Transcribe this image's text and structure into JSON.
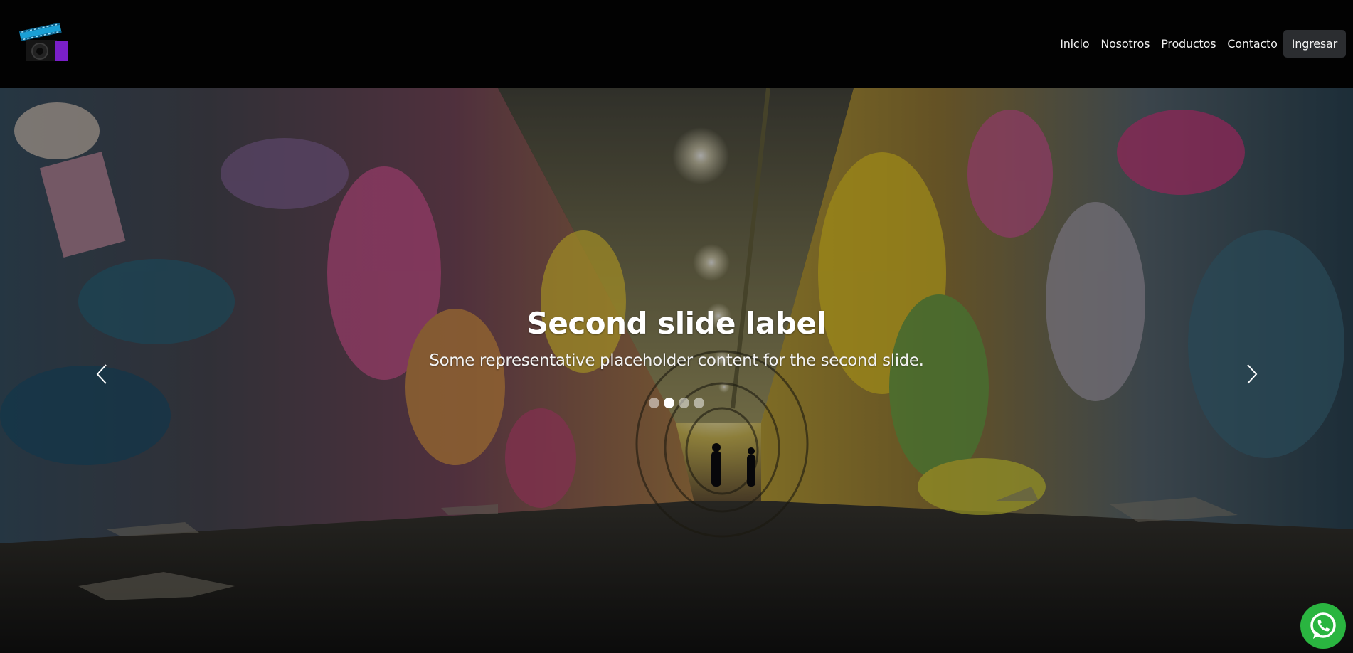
{
  "nav": {
    "logo_icon": "film-camera-icon",
    "links": [
      "Inicio",
      "Nosotros",
      "Productos",
      "Contacto"
    ],
    "login_label": "Ingresar"
  },
  "carousel": {
    "title": "Second slide label",
    "text": "Some representative placeholder content for the second slide.",
    "slide_count": 4,
    "active_index": 1,
    "prev_icon": "chevron-left-icon",
    "next_icon": "chevron-right-icon"
  },
  "floating": {
    "whatsapp_icon": "whatsapp-icon"
  },
  "colors": {
    "navbar_bg": "#020202",
    "button_bg": "#2b2d30",
    "whatsapp_green": "#2ab540"
  }
}
